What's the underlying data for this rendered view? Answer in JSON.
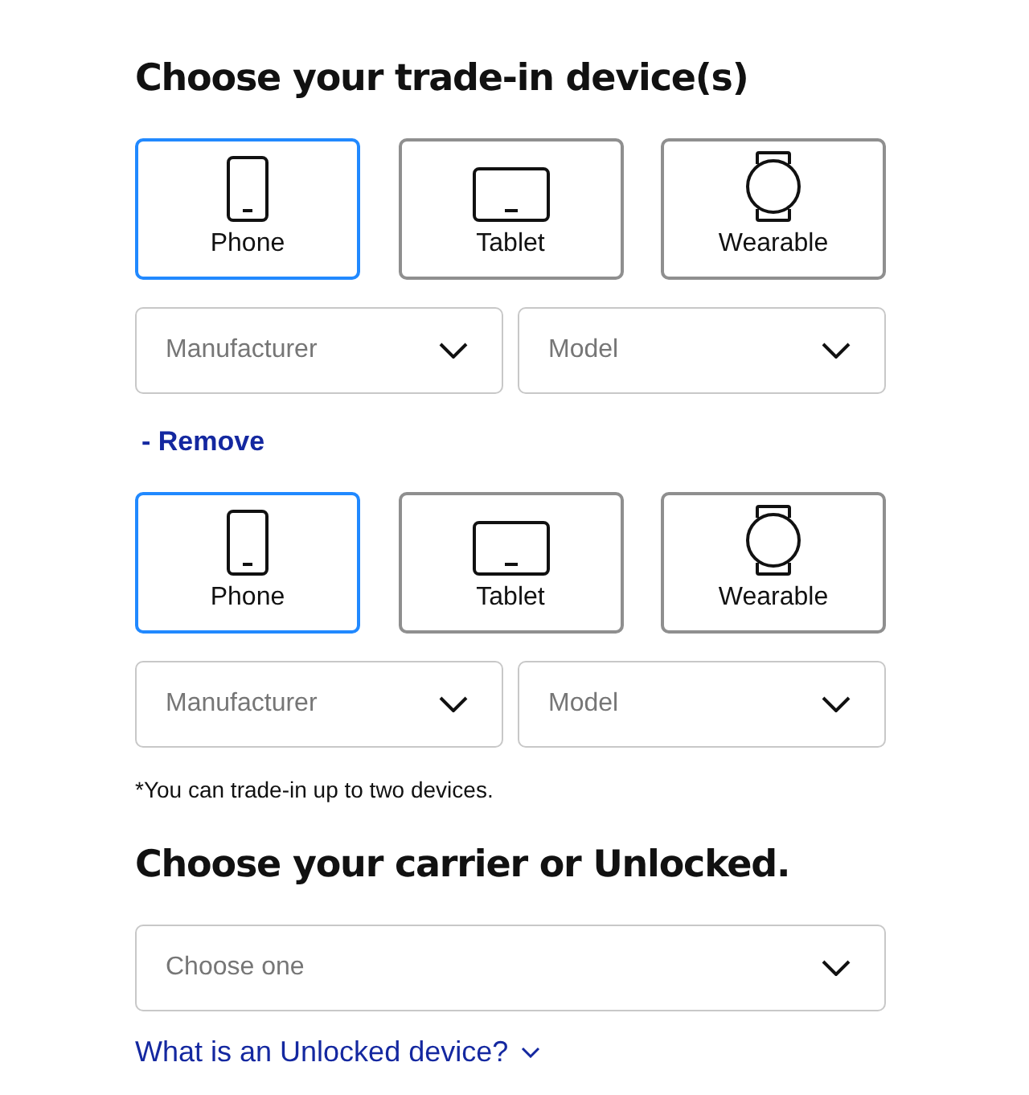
{
  "trade_in": {
    "title": "Choose your trade-in device(s)",
    "devices": [
      {
        "options": [
          {
            "kind": "phone",
            "label": "Phone",
            "selected": true
          },
          {
            "kind": "tablet",
            "label": "Tablet",
            "selected": false
          },
          {
            "kind": "wearable",
            "label": "Wearable",
            "selected": false
          }
        ],
        "selects": [
          {
            "placeholder": "Manufacturer"
          },
          {
            "placeholder": "Model"
          }
        ]
      },
      {
        "remove_link": "- Remove",
        "options": [
          {
            "kind": "phone",
            "label": "Phone",
            "selected": true
          },
          {
            "kind": "tablet",
            "label": "Tablet",
            "selected": false
          },
          {
            "kind": "wearable",
            "label": "Wearable",
            "selected": false
          }
        ],
        "selects": [
          {
            "placeholder": "Manufacturer"
          },
          {
            "placeholder": "Model"
          }
        ]
      }
    ],
    "note": "*You can trade-in up to two devices."
  },
  "carrier": {
    "title": "Choose your carrier or Unlocked.",
    "select": {
      "placeholder": "Choose one"
    },
    "info_link": "What is an Unlocked device?"
  }
}
